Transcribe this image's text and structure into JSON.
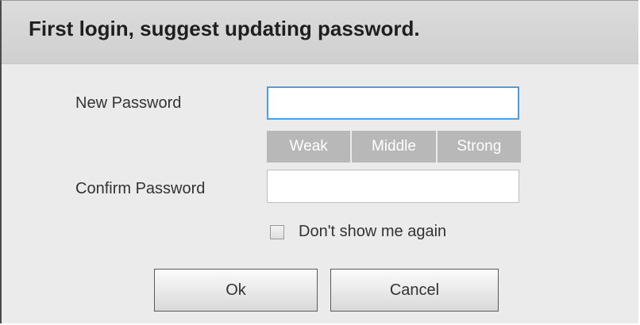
{
  "dialog": {
    "title": "First login, suggest updating password.",
    "new_password": {
      "label": "New Password",
      "value": ""
    },
    "strength": {
      "levels": [
        "Weak",
        "Middle",
        "Strong"
      ]
    },
    "confirm_password": {
      "label": "Confirm Password",
      "value": ""
    },
    "dont_show": {
      "label": "Don't show me again",
      "checked": false
    },
    "buttons": {
      "ok_label": "Ok",
      "cancel_label": "Cancel"
    }
  }
}
